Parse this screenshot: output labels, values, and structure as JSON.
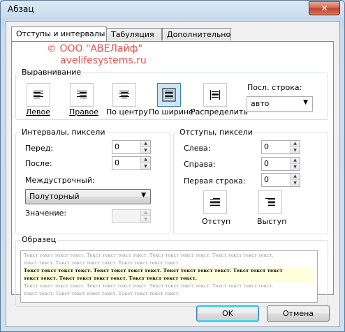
{
  "window": {
    "title": "Абзац",
    "close_glyph": "✕"
  },
  "tabs": [
    {
      "label": "Отступы и интервалы",
      "active": true
    },
    {
      "label": "Табуляция",
      "active": false
    },
    {
      "label": "Дополнительно",
      "active": false
    }
  ],
  "watermark": {
    "line1": "© ООО \"АВЕЛайф\"",
    "line2": "avelifesystems.ru"
  },
  "alignment": {
    "legend": "Выравнивание",
    "buttons": [
      {
        "label": "Левое",
        "icon": "align-left-icon",
        "pressed": false
      },
      {
        "label": "Правое",
        "icon": "align-right-icon",
        "pressed": false
      },
      {
        "label": "По центру",
        "icon": "align-center-icon",
        "pressed": false
      },
      {
        "label": "По ширине",
        "icon": "align-justify-icon",
        "pressed": true
      },
      {
        "label": "Распределить",
        "icon": "align-distribute-icon",
        "pressed": false
      }
    ],
    "last_line_label": "Посл. строка:",
    "last_line_value": "авто"
  },
  "spacing": {
    "legend": "Интервалы, пиксели",
    "before_label": "Перед:",
    "before_value": "0",
    "after_label": "После:",
    "after_value": "0",
    "line_label": "Междустрочный:",
    "line_value": "Полуторный",
    "value_label": "Значение:",
    "value_value": ""
  },
  "indents": {
    "legend": "Отступы, пиксели",
    "left_label": "Слева:",
    "left_value": "0",
    "right_label": "Справа:",
    "right_value": "0",
    "first_label": "Первая строка:",
    "first_value": "0",
    "indent_label": "Отступ",
    "outdent_label": "Выступ"
  },
  "sample": {
    "legend": "Образец",
    "prev_lines": [
      "Текст текст текст текст. Текст текст текст текст. Текст текст текст текст. Текст текст текст текст.",
      "текст текст. Текст текст текст текст. Текст текст текст текст."
    ],
    "cur_lines": [
      "Текст текст текст текст. Текст текст текст текст. Текст текст текст текст. Текст текст текст",
      "текст текст. Текст текст текст текст. Текст текст текст текст."
    ],
    "next_lines": [
      "Текст текст текст текст. Текст текст текст текст. Текст текст текст текст. Текст текст текст текст.",
      "текст текст. Текст текст текст текст. Текст текст текст текст."
    ]
  },
  "buttons": {
    "ok": "OK",
    "cancel": "Отмена"
  }
}
